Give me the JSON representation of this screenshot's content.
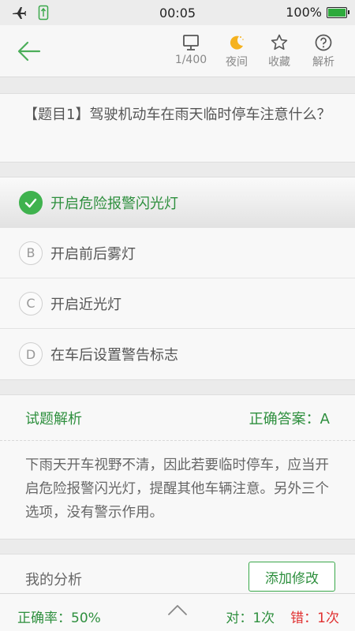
{
  "status_bar": {
    "time": "00:05",
    "battery": "100%",
    "battery_level": 1.0,
    "icons": [
      "airplane-icon",
      "usb-icon"
    ]
  },
  "toolbar": {
    "back_icon": "back-arrow-icon",
    "items": [
      {
        "icon": "monitor-icon",
        "label": "1/400"
      },
      {
        "icon": "moon-icon",
        "label": "夜间"
      },
      {
        "icon": "star-icon",
        "label": "收藏"
      },
      {
        "icon": "question-icon",
        "label": "解析"
      }
    ]
  },
  "question": {
    "text": "【题目1】驾驶机动车在雨天临时停车注意什么？"
  },
  "options": [
    {
      "marker": "A",
      "text": "开启危险报警闪光灯",
      "selected": true
    },
    {
      "marker": "B",
      "text": "开启前后雾灯",
      "selected": false
    },
    {
      "marker": "C",
      "text": "开启近光灯",
      "selected": false
    },
    {
      "marker": "D",
      "text": "在车后设置警告标志",
      "selected": false
    }
  ],
  "analysis": {
    "title": "试题解析",
    "answer": "正确答案：A",
    "body": "下雨天开车视野不清，因此若要临时停车，应当开启危险报警闪光灯，提醒其他车辆注意。另外三个选项，没有警示作用。"
  },
  "my_analysis": {
    "label": "我的分析",
    "button": "添加修改"
  },
  "bottom": {
    "accuracy": "正确率：50%",
    "right": "对：1次",
    "wrong": "错：1次"
  },
  "colors": {
    "accent": "#3fb24e",
    "error": "#e03030"
  }
}
